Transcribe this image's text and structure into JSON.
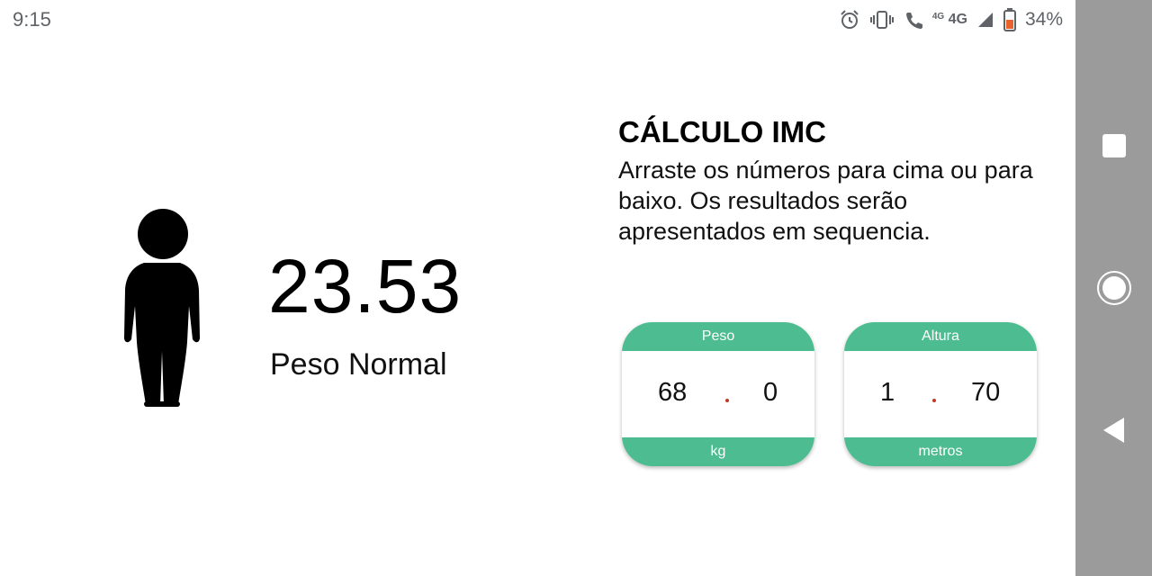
{
  "status_bar": {
    "time": "9:15",
    "network_small": "4G",
    "network": "4G",
    "battery_percent": "34%",
    "icons": [
      "alarm-icon",
      "vibrate-icon",
      "wifi-calling-icon",
      "signal-icon",
      "battery-icon"
    ]
  },
  "result": {
    "bmi": "23.53",
    "category": "Peso Normal"
  },
  "header": {
    "title": "CÁLCULO IMC",
    "instructions": "Arraste os números para cima ou para baixo. Os resultados serão apresentados em sequencia."
  },
  "weight_picker": {
    "label": "Peso",
    "integer": "68",
    "decimal": "0",
    "unit": "kg"
  },
  "height_picker": {
    "label": "Altura",
    "integer": "1",
    "decimal": "70",
    "unit": "metros"
  },
  "nav_bar": {
    "buttons": [
      "recents-icon",
      "home-icon",
      "back-icon"
    ]
  },
  "colors": {
    "accent": "#4dbd91",
    "nav_bar": "#9b9b9b",
    "decimal_dot": "#c0392b"
  }
}
